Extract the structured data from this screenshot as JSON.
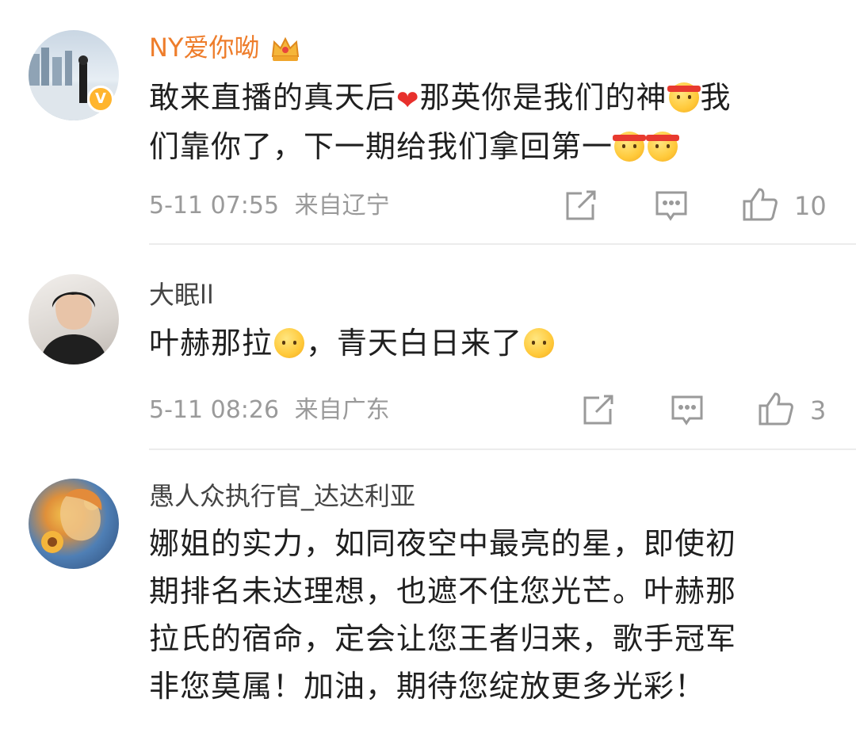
{
  "comments": [
    {
      "username": "NY爱你呦",
      "text_line1_a": "敢来直播的真天后",
      "text_line1_b": "那英你是我们的神",
      "text_line1_c": "我",
      "text_line2": "们靠你了，下一期给我们拿回第一",
      "timestamp": "5-11 07:55",
      "location": "来自辽宁",
      "likes": "10",
      "verified": "V"
    },
    {
      "username": "大眠ll",
      "text_a": "叶赫那拉",
      "text_b": "，青天白日来了",
      "timestamp": "5-11 08:26",
      "location": "来自广东",
      "likes": "3"
    },
    {
      "username": "愚人众执行官_达达利亚",
      "text_lines": [
        "娜姐的实力，如同夜空中最亮的星，即使初",
        "期排名未达理想，也遮不住您光芒。叶赫那",
        "拉氏的宿命，定会让您王者归来，歌手冠军",
        "非您莫属！加油，期待您绽放更多光彩！"
      ]
    }
  ],
  "icons": {
    "share": "share-icon",
    "comment": "comment-icon",
    "like": "thumbs-up-icon",
    "crown": "crown-icon"
  },
  "colors": {
    "vip_name": "#ee7d2b",
    "meta": "#9a9a9a",
    "badge": "#ffb52e"
  }
}
